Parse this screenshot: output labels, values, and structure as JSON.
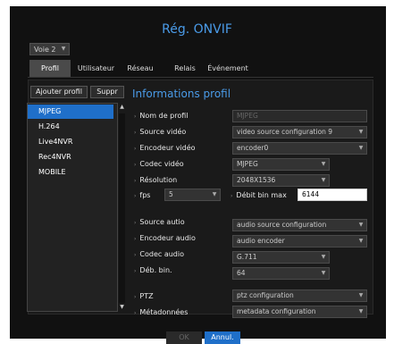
{
  "dialog": {
    "title": "Rég. ONVIF"
  },
  "channel": {
    "value": "Voie 2"
  },
  "tabs": [
    "Profil",
    "Utilisateur",
    "Réseau",
    "Relais",
    "Événement"
  ],
  "profile_buttons": {
    "add": "Ajouter profil",
    "delete": "Suppr"
  },
  "profiles": [
    "MJPEG",
    "H.264",
    "Live4NVR",
    "Rec4NVR",
    "MOBILE"
  ],
  "section_title": "Informations profil",
  "labels": {
    "profile_name": "Nom de profil",
    "video_source": "Source vidéo",
    "video_encoder": "Encodeur vidéo",
    "video_codec": "Codec vidéo",
    "resolution": "Résolution",
    "fps": "fps",
    "max_bitrate": "Débit bin max",
    "audio_source": "Source autio",
    "audio_encoder": "Encodeur audio",
    "audio_codec": "Codec audio",
    "audio_bitrate": "Déb. bin.",
    "ptz": "PTZ",
    "metadata": "Métadonnées"
  },
  "values": {
    "profile_name": "MJPEG",
    "video_source": "video source configuration 9",
    "video_encoder": "encoder0",
    "video_codec": "MJPEG",
    "resolution": "2048X1536",
    "fps": "5",
    "max_bitrate": "6144",
    "audio_source": "audio source configuration",
    "audio_encoder": "audio encoder",
    "audio_codec": "G.711",
    "audio_bitrate": "64",
    "ptz": "ptz configuration",
    "metadata": "metadata configuration"
  },
  "footer": {
    "ok": "OK",
    "cancel": "Annul."
  }
}
